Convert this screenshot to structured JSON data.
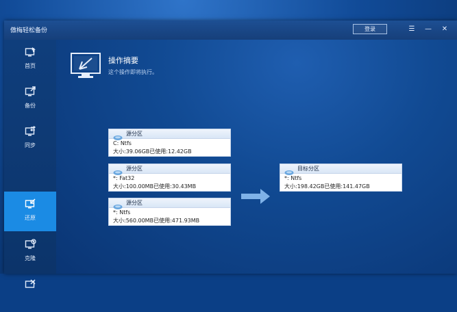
{
  "app": {
    "title": "傲梅轻松备份",
    "login_label": "登录"
  },
  "window_buttons": {
    "menu": "☰",
    "minimize": "—",
    "close": "✕"
  },
  "sidebar": {
    "items": [
      {
        "label": "首页",
        "icon": "home-icon"
      },
      {
        "label": "备份",
        "icon": "backup-icon"
      },
      {
        "label": "同步",
        "icon": "sync-icon"
      },
      {
        "label": "还原",
        "icon": "restore-icon",
        "active": true
      },
      {
        "label": "克隆",
        "icon": "clone-icon"
      },
      {
        "label": "",
        "icon": "tools-icon"
      }
    ]
  },
  "summary": {
    "title": "操作摘要",
    "subtitle": "这个操作即将执行。",
    "icon": "monitor-icon"
  },
  "sources": [
    {
      "header": "源分区",
      "line1": "C: Ntfs",
      "line2": "大小:39.06GB已使用:12.42GB"
    },
    {
      "header": "源分区",
      "line1": "*: Fat32",
      "line2": "大小:100.00MB已使用:30.43MB"
    },
    {
      "header": "源分区",
      "line1": "*: Ntfs",
      "line2": "大小:560.00MB已使用:471.93MB"
    }
  ],
  "target": {
    "header": "目标分区",
    "line1": "*: Ntfs",
    "line2": "大小:198.42GB已使用:141.47GB"
  },
  "colors": {
    "accent": "#1b8be4",
    "arrow": "#7fb2e8"
  }
}
